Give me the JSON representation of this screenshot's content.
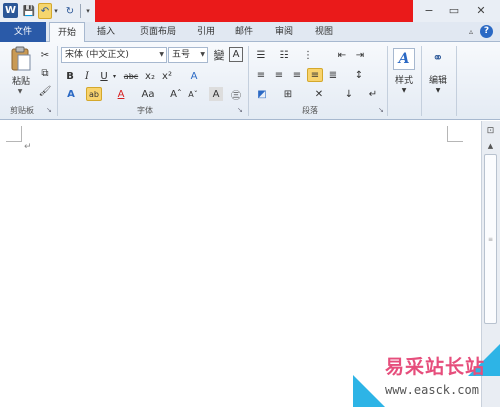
{
  "app": {
    "icon_letter": "W",
    "title_redacted": true,
    "accent": "#2a5aa8"
  },
  "qat": {
    "save": "💾",
    "undo": "↶",
    "redo": "↻",
    "dropdown": "▾",
    "customize": "▾"
  },
  "window": {
    "minimize": "−",
    "maximize": "▭",
    "close": "✕"
  },
  "tabs": {
    "file": "文件",
    "home": "开始",
    "insert": "插入",
    "layout": "页面布局",
    "references": "引用",
    "mailings": "邮件",
    "review": "审阅",
    "view": "视图",
    "active": "开始"
  },
  "ribbon": {
    "clipboard": {
      "label": "剪贴板",
      "paste": "粘贴",
      "cut": "✂",
      "copy": "⧉",
      "format_painter": "🖌"
    },
    "font": {
      "label": "字体",
      "name": "宋体 (中文正文)",
      "size": "五号",
      "grow": "A",
      "shrink": "A",
      "clear": "A",
      "bold": "B",
      "italic": "I",
      "underline": "U",
      "strikethrough": "abc",
      "subscript": "x₂",
      "superscript": "x²",
      "effects": "A",
      "highlight": "ab",
      "color": "A",
      "case": "Aa",
      "phonetic": "變",
      "border_char": "A",
      "enclose": "㊂",
      "char_shading": "A",
      "grow_small": "Aˆ",
      "shrink_small": "Aˇ"
    },
    "paragraph": {
      "label": "段落",
      "bullets": "☰",
      "numbering": "☷",
      "multilevel": "⋮",
      "decrease_indent": "⇤",
      "increase_indent": "⇥",
      "align_left": "≡",
      "center": "≡",
      "align_right": "≡",
      "justify": "≡",
      "distributed": "≣",
      "line_spacing": "↕",
      "shading": "◩",
      "borders": "⊞",
      "asian_layout": "✕",
      "sort": "↓",
      "show_marks": "↵"
    },
    "styles": {
      "label": "样式"
    },
    "editing": {
      "label": "编辑"
    }
  },
  "document": {
    "paragraph_mark": "↵"
  },
  "scrollbar": {
    "ruler": "⊡",
    "up": "▲"
  },
  "watermark": {
    "title": "易采站长站",
    "url": "www.easck.com"
  }
}
